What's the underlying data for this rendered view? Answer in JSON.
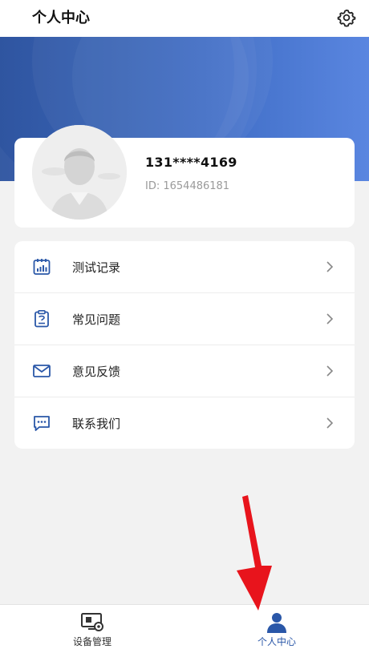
{
  "header": {
    "title": "个人中心"
  },
  "profile": {
    "phone": "131****4169",
    "id_text": "ID: 1654486181"
  },
  "menu": {
    "items": [
      {
        "label": "测试记录",
        "icon": "test-record-icon"
      },
      {
        "label": "常见问题",
        "icon": "faq-icon"
      },
      {
        "label": "意见反馈",
        "icon": "mail-icon"
      },
      {
        "label": "联系我们",
        "icon": "chat-icon"
      }
    ]
  },
  "bottom_nav": {
    "items": [
      {
        "label": "设备管理",
        "icon": "device-management-icon",
        "active": false
      },
      {
        "label": "个人中心",
        "icon": "person-icon",
        "active": true
      }
    ]
  },
  "colors": {
    "accent": "#2a57a8",
    "banner_start": "#2f55a0",
    "banner_end": "#5a86e0",
    "annotation_arrow": "#e8141c",
    "inactive_nav": "#333333"
  }
}
